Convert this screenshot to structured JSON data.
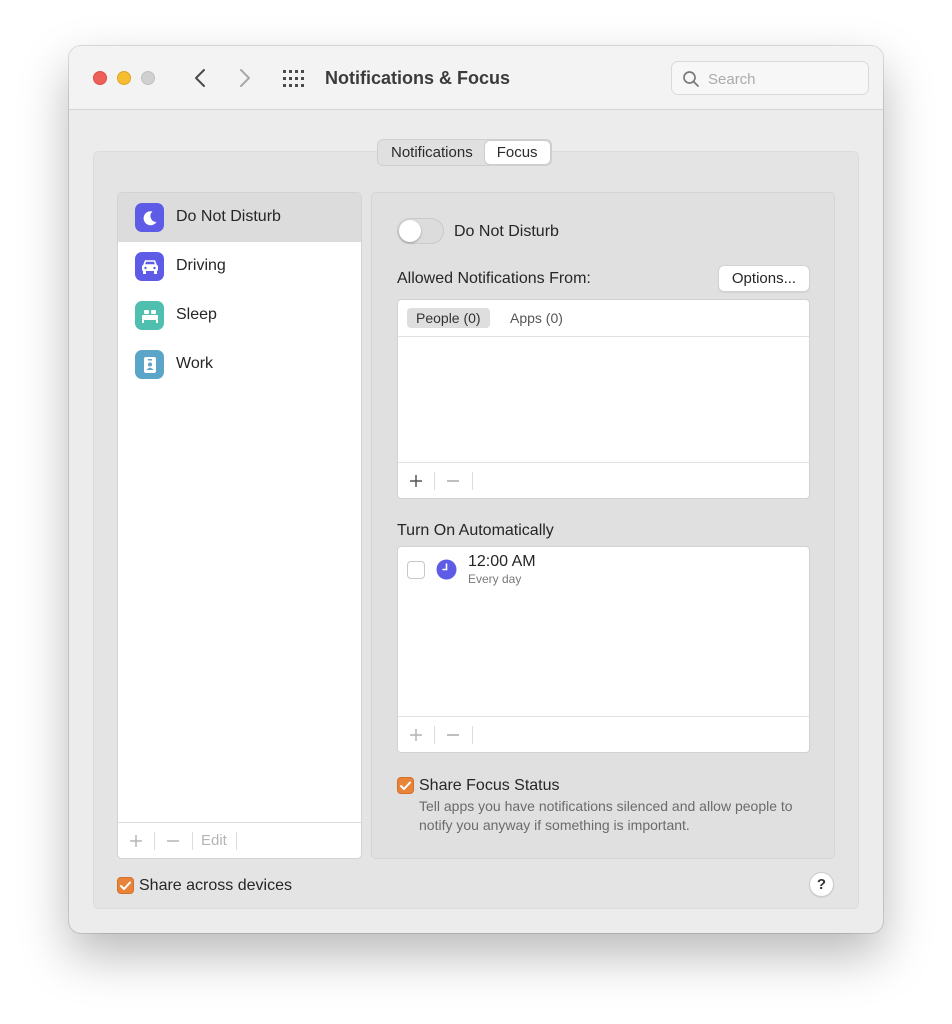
{
  "window": {
    "title": "Notifications & Focus",
    "search_placeholder": "Search"
  },
  "tabs": [
    {
      "label": "Notifications",
      "active": false
    },
    {
      "label": "Focus",
      "active": true
    }
  ],
  "focus_list": {
    "items": [
      {
        "label": "Do Not Disturb",
        "icon": "moon-icon",
        "color": "#5e5ce6",
        "selected": true
      },
      {
        "label": "Driving",
        "icon": "car-icon",
        "color": "#5e5ce6",
        "selected": false
      },
      {
        "label": "Sleep",
        "icon": "bed-icon",
        "color": "#4fbfb0",
        "selected": false
      },
      {
        "label": "Work",
        "icon": "badge-icon",
        "color": "#5aa5c8",
        "selected": false
      }
    ],
    "edit_label": "Edit"
  },
  "detail": {
    "toggle_label": "Do Not Disturb",
    "toggle_on": false,
    "allowed_label": "Allowed Notifications From:",
    "options_label": "Options...",
    "people_tab": "People (0)",
    "apps_tab": "Apps (0)",
    "turn_on_label": "Turn On Automatically",
    "schedule": {
      "time": "12:00 AM",
      "repeat": "Every day",
      "enabled": false
    },
    "share_status_label": "Share Focus Status",
    "share_status_desc": "Tell apps you have notifications silenced and allow people to notify you anyway if something is important.",
    "share_status_checked": true
  },
  "footer": {
    "share_across_label": "Share across devices",
    "share_across_checked": true,
    "help_label": "?"
  },
  "colors": {
    "accent": "#e8833a",
    "focus_purple": "#5e5ce6"
  }
}
